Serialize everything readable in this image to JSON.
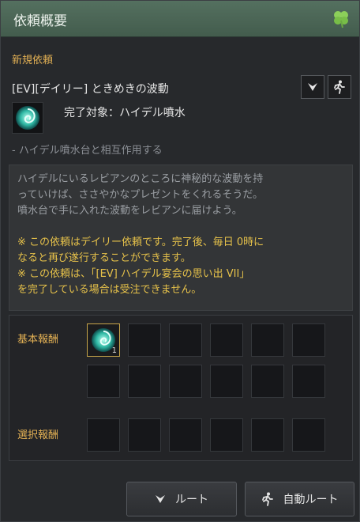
{
  "window": {
    "title": "依頼概要",
    "title_icon": "clover-icon"
  },
  "quest": {
    "section": "新規依頼",
    "name": "[EV][デイリー] ときめきの波動",
    "target": "完了対象：ハイデル噴水",
    "hint": "- ハイデル噴水台と相互作用する",
    "description": [
      {
        "text": "ハイデルにいるレビアンのところに神秘的な波動を持",
        "style": "gray"
      },
      {
        "text": "っていけば、ささやかなプレゼントをくれるそうだ。",
        "style": "gray"
      },
      {
        "text": "噴水台で手に入れた波動をレビアンに届けよう。",
        "style": "gray"
      },
      {
        "text": "",
        "style": "gap"
      },
      {
        "text": "※ この依頼はデイリー依頼です。完了後、毎日 0時に",
        "style": "yellow"
      },
      {
        "text": "なると再び遂行することができます。",
        "style": "yellow"
      },
      {
        "text": "※ この依頼は、「[EV] ハイデル宴会の思い出 VII」",
        "style": "yellow"
      },
      {
        "text": "を完了している場合は受注できません。",
        "style": "yellow"
      }
    ]
  },
  "rewards": {
    "basic_label": "基本報酬",
    "select_label": "選択報酬",
    "basic_item_count": "1"
  },
  "buttons": {
    "route": "ルート",
    "auto_route": "自動ルート"
  },
  "colors": {
    "accent": "#e2b054",
    "titlebar": "#4d6757",
    "notice": "#e7c24a"
  }
}
